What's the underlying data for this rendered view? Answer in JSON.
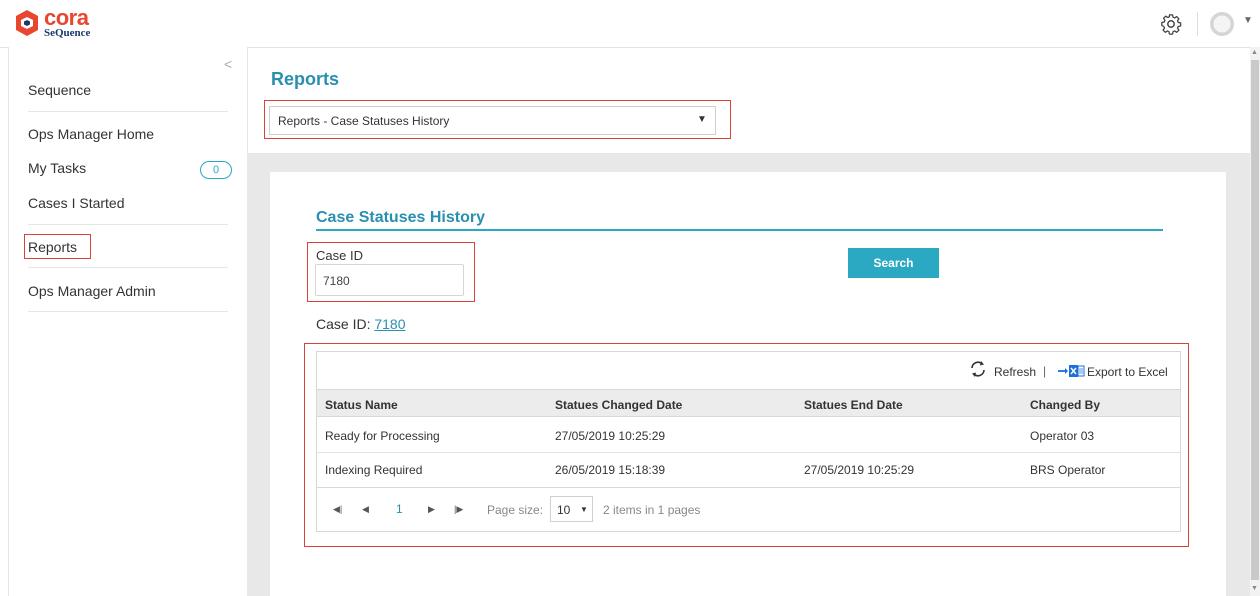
{
  "header": {
    "logo_primary": "cora",
    "logo_secondary": "SeQuence",
    "icons": [
      "gear-icon",
      "avatar-icon",
      "chevron-down-icon"
    ]
  },
  "sidebar": {
    "items": [
      {
        "label": "Sequence"
      },
      {
        "label": "Ops Manager Home"
      },
      {
        "label": "My Tasks",
        "badge": "0"
      },
      {
        "label": "Cases I Started"
      },
      {
        "label": "Reports",
        "selected": true
      },
      {
        "label": "Ops Manager Admin"
      }
    ]
  },
  "main": {
    "title": "Reports",
    "report_select": {
      "value": "Reports - Case Statuses History"
    }
  },
  "report": {
    "title": "Case Statuses History",
    "case_id_label": "Case ID",
    "case_id_value": "7180",
    "search_label": "Search",
    "result_prefix": "Case ID: ",
    "result_case_id": "7180"
  },
  "grid": {
    "toolbar": {
      "refresh_label": "Refresh",
      "separator": "|",
      "export_label": "Export to Excel"
    },
    "columns": [
      "Status Name",
      "Statues Changed Date",
      "Statues End Date",
      "Changed By"
    ],
    "rows": [
      [
        "Ready for Processing",
        "27/05/2019 10:25:29",
        "",
        "Operator 03"
      ],
      [
        "Indexing Required",
        "26/05/2019 15:18:39",
        "27/05/2019 10:25:29",
        "BRS Operator"
      ]
    ],
    "pager": {
      "current_page": "1",
      "page_size_label": "Page size:",
      "page_size": "10",
      "summary": "2 items in 1 pages"
    }
  },
  "colors": {
    "accent": "#2ca9c2",
    "title": "#2a8fb0",
    "brand_red": "#e8462f",
    "highlight_border": "#d9413a"
  }
}
